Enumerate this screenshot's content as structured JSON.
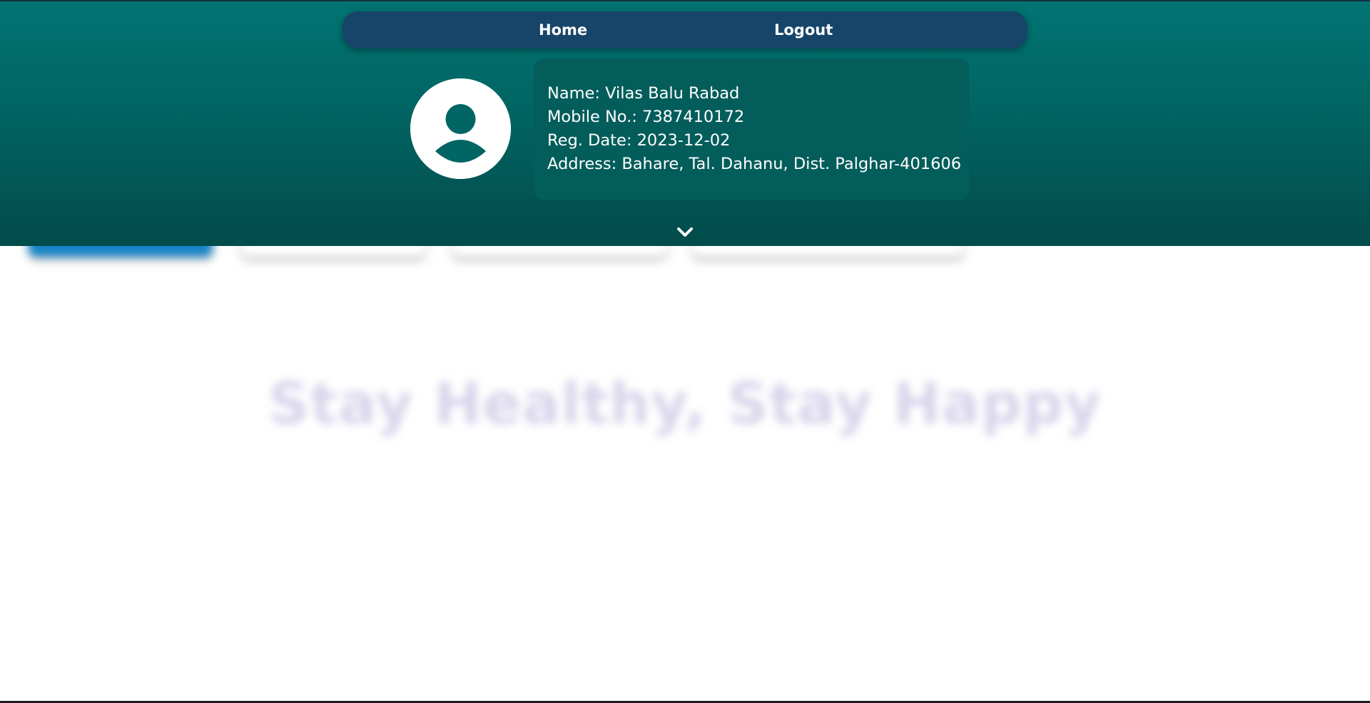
{
  "nav": {
    "home_label": "Home",
    "logout_label": "Logout"
  },
  "profile": {
    "name_line": "Name: Vilas Balu Rabad",
    "mobile_line": "Mobile No.: 7387410172",
    "reg_date_line": "Reg. Date: 2023-12-02",
    "address_line": "Address: Bahare, Tal. Dahanu, Dist. Palghar-401606"
  },
  "background": {
    "heading": "Stay Healthy, Stay Happy"
  },
  "icons": {
    "avatar": "user-avatar-icon",
    "toggle": "chevron-down-icon"
  },
  "colors": {
    "header_top": "#017573",
    "header_bottom": "#024b4b",
    "navbar": "#17456a",
    "profile_card": "#035d5b",
    "active_tab": "#1583c8",
    "heading_text": "#d6d4ea"
  }
}
